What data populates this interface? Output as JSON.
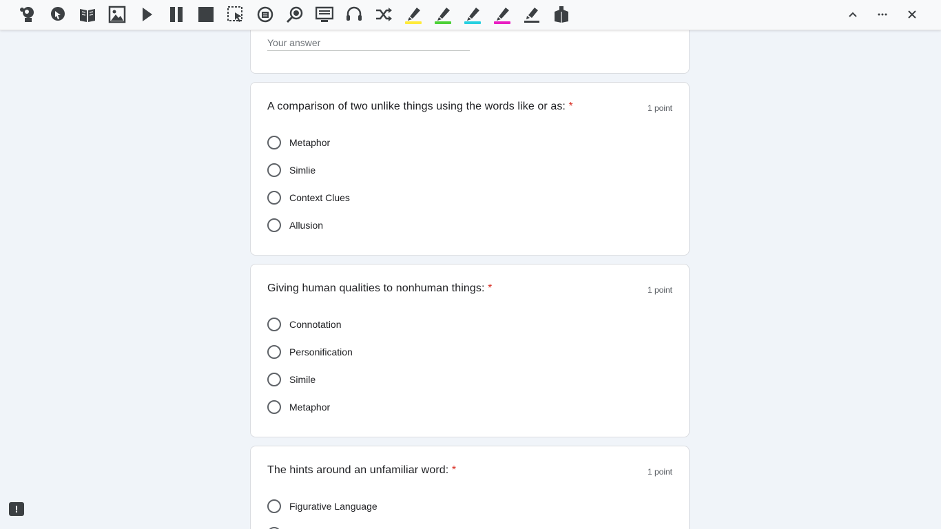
{
  "toolbar": {
    "tools": [
      "hover-speech",
      "point-to-speak",
      "dictionary",
      "picture-dictionary",
      "play",
      "pause",
      "stop",
      "screenshot-reader",
      "audio-maker",
      "screen-mask",
      "simplify",
      "talk-and-type",
      "rewordify",
      "highlight-yellow",
      "highlight-green",
      "highlight-cyan",
      "highlight-pink",
      "clear-highlights",
      "vocabulary"
    ],
    "highlight_colors": {
      "yellow": "#ffeb3b",
      "green": "#4cd137",
      "cyan": "#26d0e0",
      "pink": "#e91ec2"
    }
  },
  "previous_answer": {
    "placeholder": "Your answer"
  },
  "questions": [
    {
      "title": "A comparison of two unlike things using the words like or as:",
      "required_mark": "*",
      "points": "1 point",
      "options": [
        "Metaphor",
        "Simlie",
        "Context Clues",
        "Allusion"
      ]
    },
    {
      "title": "Giving human qualities to nonhuman things:",
      "required_mark": "*",
      "points": "1 point",
      "options": [
        "Connotation",
        "Personification",
        "Simile",
        "Metaphor"
      ]
    },
    {
      "title": "The hints around an unfamiliar word:",
      "required_mark": "*",
      "points": "1 point",
      "options": [
        "Figurative Language"
      ]
    }
  ],
  "report_button": "!"
}
